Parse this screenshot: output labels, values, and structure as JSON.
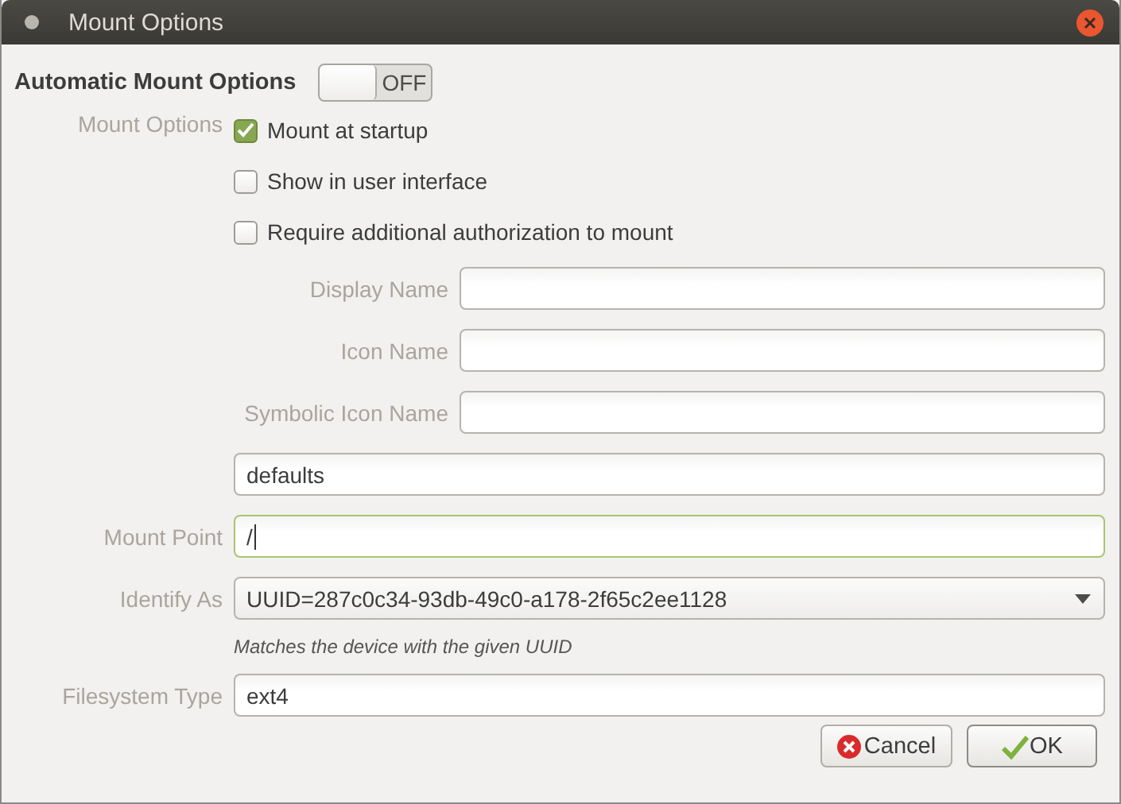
{
  "window": {
    "title": "Mount Options"
  },
  "automatic": {
    "label": "Automatic Mount Options",
    "switch_text": "OFF",
    "on": false
  },
  "mount_options": {
    "label": "Mount Options",
    "checkboxes": [
      {
        "label": "Mount at startup",
        "checked": true
      },
      {
        "label": "Show in user interface",
        "checked": false
      },
      {
        "label": "Require additional authorization to mount",
        "checked": false
      }
    ]
  },
  "fields": [
    {
      "kind": "sub",
      "label": "Display Name",
      "focused": false
    },
    {
      "kind": "sub",
      "label": "Icon Name",
      "focused": false
    },
    {
      "kind": "sub",
      "label": "Symbolic Icon Name",
      "focused": false
    },
    {
      "kind": "text",
      "value": "defaults",
      "focused": false
    },
    {
      "kind": "text",
      "label": "Mount Point",
      "value": "/",
      "focused": true
    },
    {
      "kind": "combo",
      "label": "Identify As",
      "value": "UUID=287c0c34-93db-49c0-a178-2f65c2ee1128"
    },
    {
      "kind": "hint",
      "value": "Matches the device with the given UUID"
    },
    {
      "kind": "text",
      "label": "Filesystem Type",
      "value": "ext4",
      "focused": false
    }
  ],
  "buttons": [
    {
      "kind": "cancel",
      "label": "Cancel"
    },
    {
      "kind": "ok",
      "label": "OK"
    }
  ]
}
